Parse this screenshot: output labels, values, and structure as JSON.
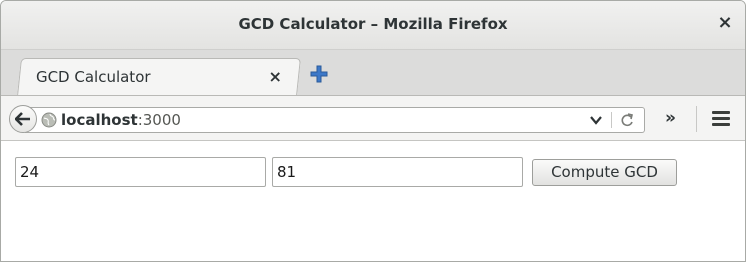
{
  "window": {
    "title": "GCD Calculator – Mozilla Firefox",
    "close_glyph": "×"
  },
  "tabs": [
    {
      "label": "GCD Calculator",
      "close_glyph": "×"
    }
  ],
  "navbar": {
    "url_host": "localhost",
    "url_port": ":3000",
    "overflow_glyph": "»"
  },
  "form": {
    "input_a": "24",
    "input_b": "81",
    "submit_label": "Compute GCD"
  },
  "icons": {
    "back": "back-arrow-icon",
    "globe": "globe-icon",
    "new_tab": "plus-icon",
    "dropdown": "chevron-down-icon",
    "reload": "reload-icon",
    "menu": "hamburger-menu-icon"
  },
  "colors": {
    "new_tab_plus": "#3c78c8"
  }
}
